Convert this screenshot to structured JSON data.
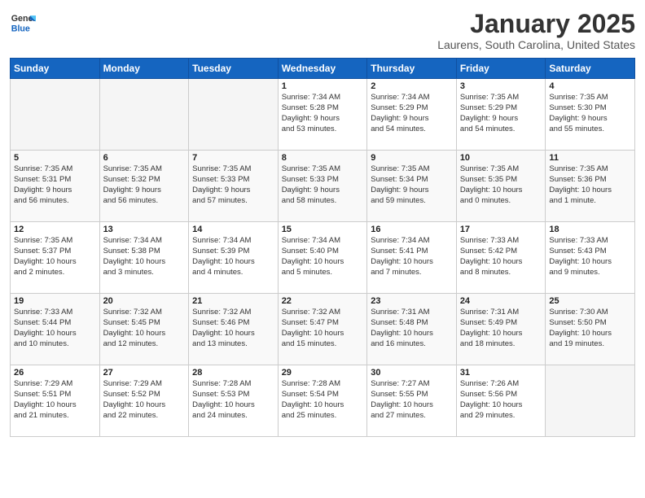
{
  "header": {
    "logo_line1": "General",
    "logo_line2": "Blue",
    "title": "January 2025",
    "subtitle": "Laurens, South Carolina, United States"
  },
  "days_of_week": [
    "Sunday",
    "Monday",
    "Tuesday",
    "Wednesday",
    "Thursday",
    "Friday",
    "Saturday"
  ],
  "weeks": [
    [
      {
        "day": "",
        "info": ""
      },
      {
        "day": "",
        "info": ""
      },
      {
        "day": "",
        "info": ""
      },
      {
        "day": "1",
        "info": "Sunrise: 7:34 AM\nSunset: 5:28 PM\nDaylight: 9 hours\nand 53 minutes."
      },
      {
        "day": "2",
        "info": "Sunrise: 7:34 AM\nSunset: 5:29 PM\nDaylight: 9 hours\nand 54 minutes."
      },
      {
        "day": "3",
        "info": "Sunrise: 7:35 AM\nSunset: 5:29 PM\nDaylight: 9 hours\nand 54 minutes."
      },
      {
        "day": "4",
        "info": "Sunrise: 7:35 AM\nSunset: 5:30 PM\nDaylight: 9 hours\nand 55 minutes."
      }
    ],
    [
      {
        "day": "5",
        "info": "Sunrise: 7:35 AM\nSunset: 5:31 PM\nDaylight: 9 hours\nand 56 minutes."
      },
      {
        "day": "6",
        "info": "Sunrise: 7:35 AM\nSunset: 5:32 PM\nDaylight: 9 hours\nand 56 minutes."
      },
      {
        "day": "7",
        "info": "Sunrise: 7:35 AM\nSunset: 5:33 PM\nDaylight: 9 hours\nand 57 minutes."
      },
      {
        "day": "8",
        "info": "Sunrise: 7:35 AM\nSunset: 5:33 PM\nDaylight: 9 hours\nand 58 minutes."
      },
      {
        "day": "9",
        "info": "Sunrise: 7:35 AM\nSunset: 5:34 PM\nDaylight: 9 hours\nand 59 minutes."
      },
      {
        "day": "10",
        "info": "Sunrise: 7:35 AM\nSunset: 5:35 PM\nDaylight: 10 hours\nand 0 minutes."
      },
      {
        "day": "11",
        "info": "Sunrise: 7:35 AM\nSunset: 5:36 PM\nDaylight: 10 hours\nand 1 minute."
      }
    ],
    [
      {
        "day": "12",
        "info": "Sunrise: 7:35 AM\nSunset: 5:37 PM\nDaylight: 10 hours\nand 2 minutes."
      },
      {
        "day": "13",
        "info": "Sunrise: 7:34 AM\nSunset: 5:38 PM\nDaylight: 10 hours\nand 3 minutes."
      },
      {
        "day": "14",
        "info": "Sunrise: 7:34 AM\nSunset: 5:39 PM\nDaylight: 10 hours\nand 4 minutes."
      },
      {
        "day": "15",
        "info": "Sunrise: 7:34 AM\nSunset: 5:40 PM\nDaylight: 10 hours\nand 5 minutes."
      },
      {
        "day": "16",
        "info": "Sunrise: 7:34 AM\nSunset: 5:41 PM\nDaylight: 10 hours\nand 7 minutes."
      },
      {
        "day": "17",
        "info": "Sunrise: 7:33 AM\nSunset: 5:42 PM\nDaylight: 10 hours\nand 8 minutes."
      },
      {
        "day": "18",
        "info": "Sunrise: 7:33 AM\nSunset: 5:43 PM\nDaylight: 10 hours\nand 9 minutes."
      }
    ],
    [
      {
        "day": "19",
        "info": "Sunrise: 7:33 AM\nSunset: 5:44 PM\nDaylight: 10 hours\nand 10 minutes."
      },
      {
        "day": "20",
        "info": "Sunrise: 7:32 AM\nSunset: 5:45 PM\nDaylight: 10 hours\nand 12 minutes."
      },
      {
        "day": "21",
        "info": "Sunrise: 7:32 AM\nSunset: 5:46 PM\nDaylight: 10 hours\nand 13 minutes."
      },
      {
        "day": "22",
        "info": "Sunrise: 7:32 AM\nSunset: 5:47 PM\nDaylight: 10 hours\nand 15 minutes."
      },
      {
        "day": "23",
        "info": "Sunrise: 7:31 AM\nSunset: 5:48 PM\nDaylight: 10 hours\nand 16 minutes."
      },
      {
        "day": "24",
        "info": "Sunrise: 7:31 AM\nSunset: 5:49 PM\nDaylight: 10 hours\nand 18 minutes."
      },
      {
        "day": "25",
        "info": "Sunrise: 7:30 AM\nSunset: 5:50 PM\nDaylight: 10 hours\nand 19 minutes."
      }
    ],
    [
      {
        "day": "26",
        "info": "Sunrise: 7:29 AM\nSunset: 5:51 PM\nDaylight: 10 hours\nand 21 minutes."
      },
      {
        "day": "27",
        "info": "Sunrise: 7:29 AM\nSunset: 5:52 PM\nDaylight: 10 hours\nand 22 minutes."
      },
      {
        "day": "28",
        "info": "Sunrise: 7:28 AM\nSunset: 5:53 PM\nDaylight: 10 hours\nand 24 minutes."
      },
      {
        "day": "29",
        "info": "Sunrise: 7:28 AM\nSunset: 5:54 PM\nDaylight: 10 hours\nand 25 minutes."
      },
      {
        "day": "30",
        "info": "Sunrise: 7:27 AM\nSunset: 5:55 PM\nDaylight: 10 hours\nand 27 minutes."
      },
      {
        "day": "31",
        "info": "Sunrise: 7:26 AM\nSunset: 5:56 PM\nDaylight: 10 hours\nand 29 minutes."
      },
      {
        "day": "",
        "info": ""
      }
    ]
  ]
}
